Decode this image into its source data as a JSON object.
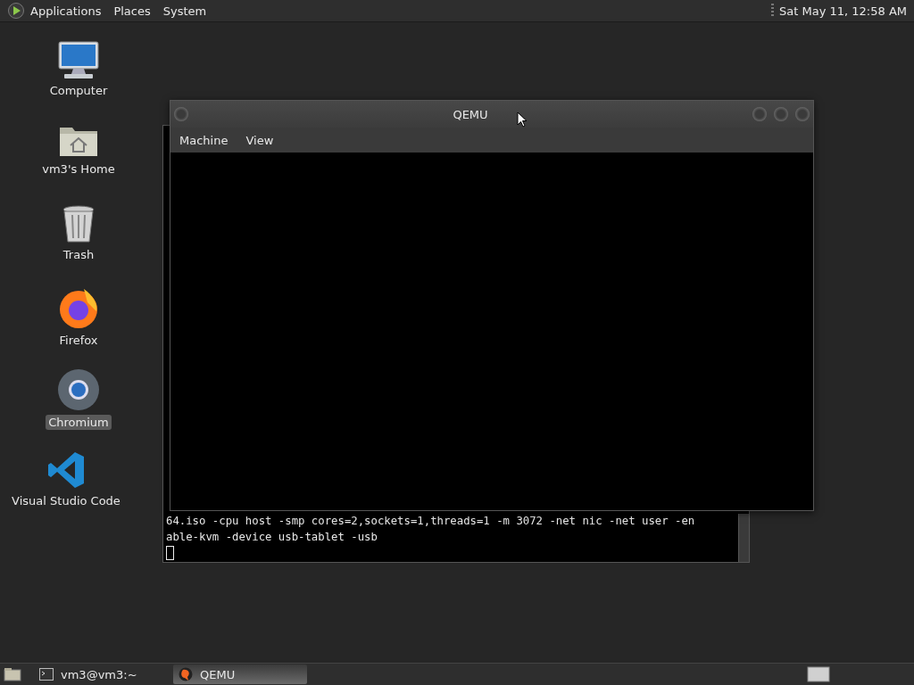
{
  "top_panel": {
    "menus": [
      "Applications",
      "Places",
      "System"
    ],
    "clock": "Sat May 11, 12:58 AM"
  },
  "desktop_icons": [
    {
      "label": "Computer",
      "kind": "computer",
      "selected": false
    },
    {
      "label": "vm3's Home",
      "kind": "home",
      "selected": false
    },
    {
      "label": "Trash",
      "kind": "trash",
      "selected": false
    },
    {
      "label": "Firefox",
      "kind": "firefox",
      "selected": false
    },
    {
      "label": "Chromium",
      "kind": "chromium",
      "selected": true
    },
    {
      "label": "Visual Studio Code",
      "kind": "vscode",
      "selected": false
    }
  ],
  "terminal": {
    "lines": [
      "64.iso -cpu host -smp cores=2,sockets=1,threads=1 -m 3072 -net nic -net user -en",
      "able-kvm -device usb-tablet -usb"
    ]
  },
  "qemu_window": {
    "title": "QEMU",
    "menus": [
      "Machine",
      "View"
    ]
  },
  "taskbar": {
    "items": [
      {
        "label": "vm3@vm3:~",
        "kind": "terminal",
        "selected": false
      },
      {
        "label": "QEMU",
        "kind": "qemu",
        "selected": true
      }
    ]
  }
}
